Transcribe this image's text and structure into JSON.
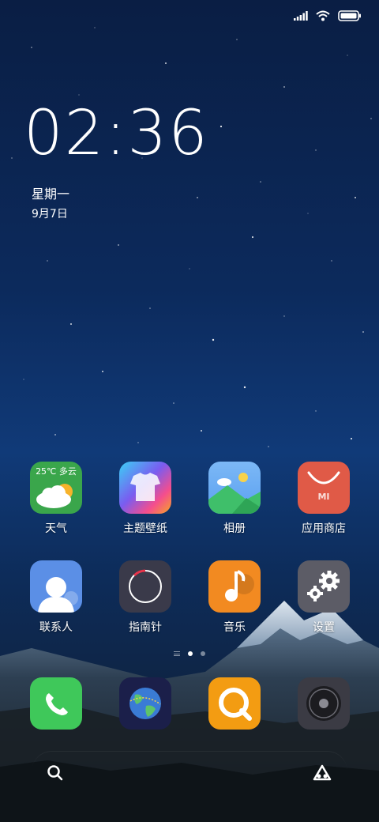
{
  "status_bar": {
    "signal_icon": "signal-icon",
    "wifi_icon": "wifi-icon",
    "battery_icon": "battery-icon"
  },
  "clock": {
    "time": "02:36",
    "weekday": "星期一",
    "date": "9月7日"
  },
  "home_apps": [
    {
      "label": "天气",
      "icon": "weather-icon",
      "widget_text": "25℃ 多云"
    },
    {
      "label": "主题壁纸",
      "icon": "themes-icon"
    },
    {
      "label": "相册",
      "icon": "gallery-icon"
    },
    {
      "label": "应用商店",
      "icon": "app-store-icon",
      "logo_text": "MI"
    },
    {
      "label": "联系人",
      "icon": "contacts-icon"
    },
    {
      "label": "指南针",
      "icon": "compass-icon"
    },
    {
      "label": "音乐",
      "icon": "music-icon"
    },
    {
      "label": "设置",
      "icon": "settings-icon"
    }
  ],
  "page_indicator": {
    "pages": 2,
    "active": 0
  },
  "dock": [
    {
      "icon": "phone-icon"
    },
    {
      "icon": "browser-icon"
    },
    {
      "icon": "messages-icon"
    },
    {
      "icon": "camera-icon"
    }
  ],
  "bottom_bar": {
    "search_icon": "search-icon",
    "assistant_icon": "assistant-icon"
  },
  "colors": {
    "weather": "#3aa64b",
    "gallery": "#5aa0f0",
    "store": "#e05a47",
    "contacts": "#5b8fe6",
    "compass": "#3a3a4a",
    "music": "#f28a21",
    "settings": "#5c5c66",
    "phone": "#3fc85a",
    "browser": "#1b1f4a",
    "messages": "#f39c12",
    "camera": "#3b3b44"
  }
}
